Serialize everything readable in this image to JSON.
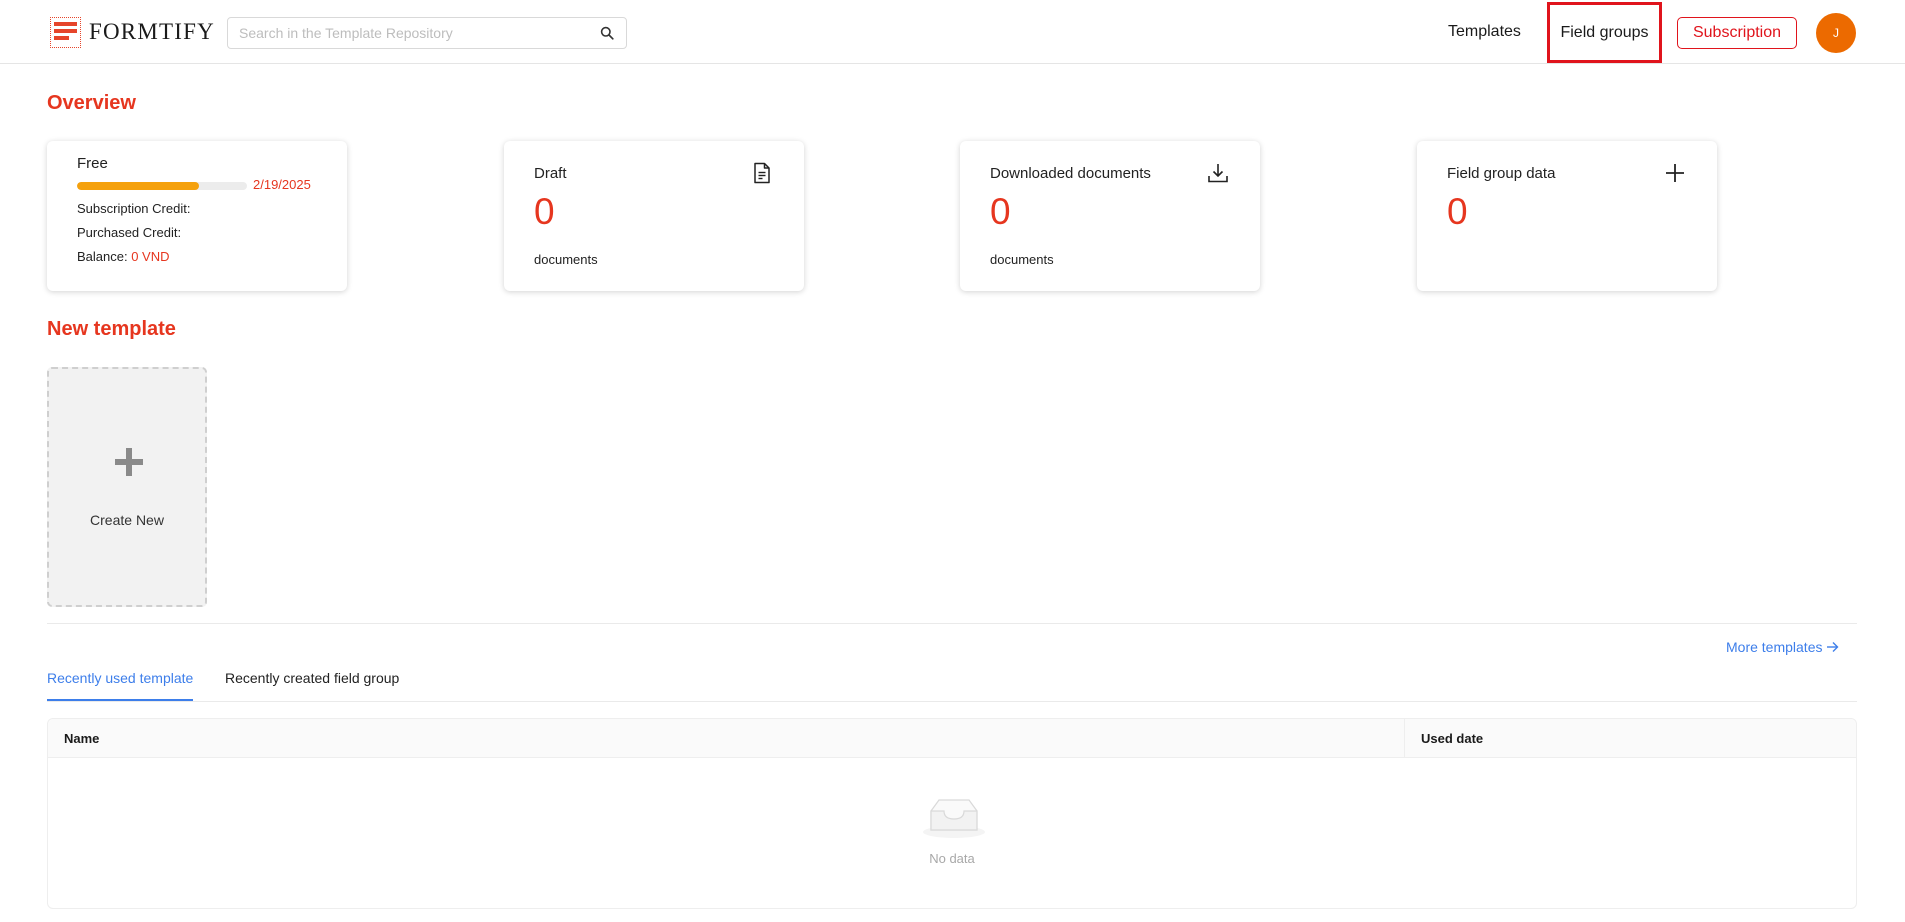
{
  "header": {
    "logo_text": "FORMTIFY",
    "search_placeholder": "Search in the Template Repository",
    "nav": {
      "templates": "Templates",
      "field_groups": "Field groups",
      "subscription": "Subscription"
    },
    "avatar_initial": "J",
    "accent_color": "#e6361f"
  },
  "overview": {
    "title": "Overview",
    "plan": {
      "name": "Free",
      "progress_fraction": 0.72,
      "expiry_date": "2/19/2025",
      "subscription_credit_label": "Subscription Credit:",
      "purchased_credit_label": "Purchased Credit:",
      "balance_label": "Balance:",
      "balance_value": "0 VND"
    },
    "cards": {
      "draft": {
        "label": "Draft",
        "value": "0",
        "unit": "documents",
        "icon": "document-icon"
      },
      "downloaded": {
        "label": "Downloaded documents",
        "value": "0",
        "unit": "documents",
        "icon": "download-icon"
      },
      "field_group_data": {
        "label": "Field group data",
        "value": "0",
        "icon": "plus-icon"
      }
    }
  },
  "new_template": {
    "title": "New template",
    "create_label": "Create New"
  },
  "recent": {
    "more_link": "More templates",
    "tabs": [
      {
        "label": "Recently used template",
        "active": true
      },
      {
        "label": "Recently created field group",
        "active": false
      }
    ],
    "table": {
      "columns": [
        "Name",
        "Used date"
      ],
      "rows": [],
      "empty_text": "No data"
    }
  }
}
